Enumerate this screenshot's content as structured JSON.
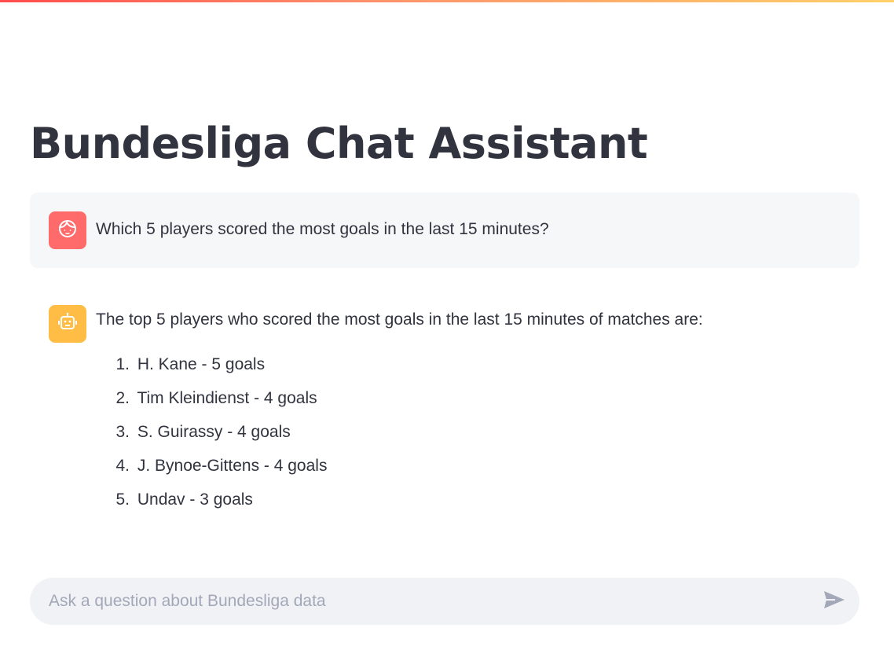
{
  "app": {
    "title": "Bundesliga Chat Assistant"
  },
  "messages": {
    "user": {
      "avatar_icon": "user-face-icon",
      "text": "Which 5 players scored the most goals in the last 15 minutes?"
    },
    "assistant": {
      "avatar_icon": "robot-icon",
      "text": "The top 5 players who scored the most goals in the last 15 minutes of matches are:",
      "list": [
        {
          "num": "1.",
          "text": "H. Kane - 5 goals"
        },
        {
          "num": "2.",
          "text": "Tim Kleindienst - 4 goals"
        },
        {
          "num": "3.",
          "text": "S. Guirassy - 4 goals"
        },
        {
          "num": "4.",
          "text": "J. Bynoe-Gittens - 4 goals"
        },
        {
          "num": "5.",
          "text": "Undav - 3 goals"
        }
      ]
    }
  },
  "chat_input": {
    "placeholder": "Ask a question about Bundesliga data",
    "value": "",
    "send_icon": "send-icon"
  },
  "colors": {
    "accent_gradient_start": "#ff4b4b",
    "accent_gradient_end": "#ffd16a",
    "user_avatar": "#ff6b6b",
    "assistant_avatar": "#ffbd45",
    "text": "#31333f"
  }
}
